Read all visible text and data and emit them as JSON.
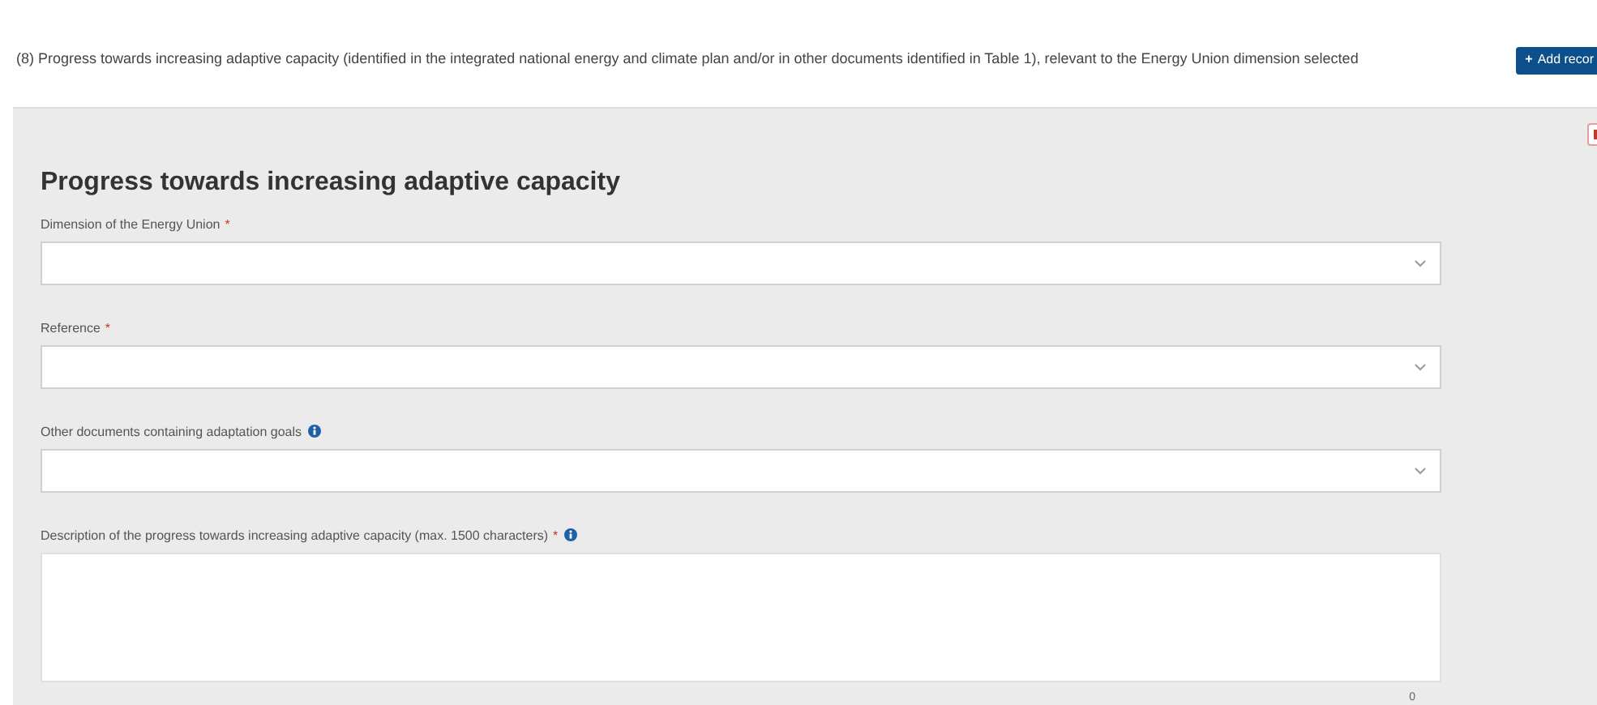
{
  "section": {
    "title": "(8) Progress towards increasing adaptive capacity (identified in the integrated national energy and climate plan and/or in other documents identified in Table 1), relevant to the Energy Union dimension selected",
    "add_button": {
      "icon": "+",
      "label": "Add recor"
    }
  },
  "form": {
    "heading": "Progress towards increasing adaptive capacity",
    "fields": [
      {
        "kind": "select",
        "label": "Dimension of the Energy Union",
        "required_mark": "*",
        "info": false
      },
      {
        "kind": "select",
        "label": "Reference",
        "required_mark": "*",
        "info": false
      },
      {
        "kind": "select",
        "label": "Other documents containing adaptation goals",
        "info": true
      },
      {
        "kind": "textarea",
        "label": "Description of the progress towards increasing adaptive capacity (max. 1500 characters)",
        "required_mark": "*",
        "info": true,
        "counter": "0"
      }
    ]
  }
}
